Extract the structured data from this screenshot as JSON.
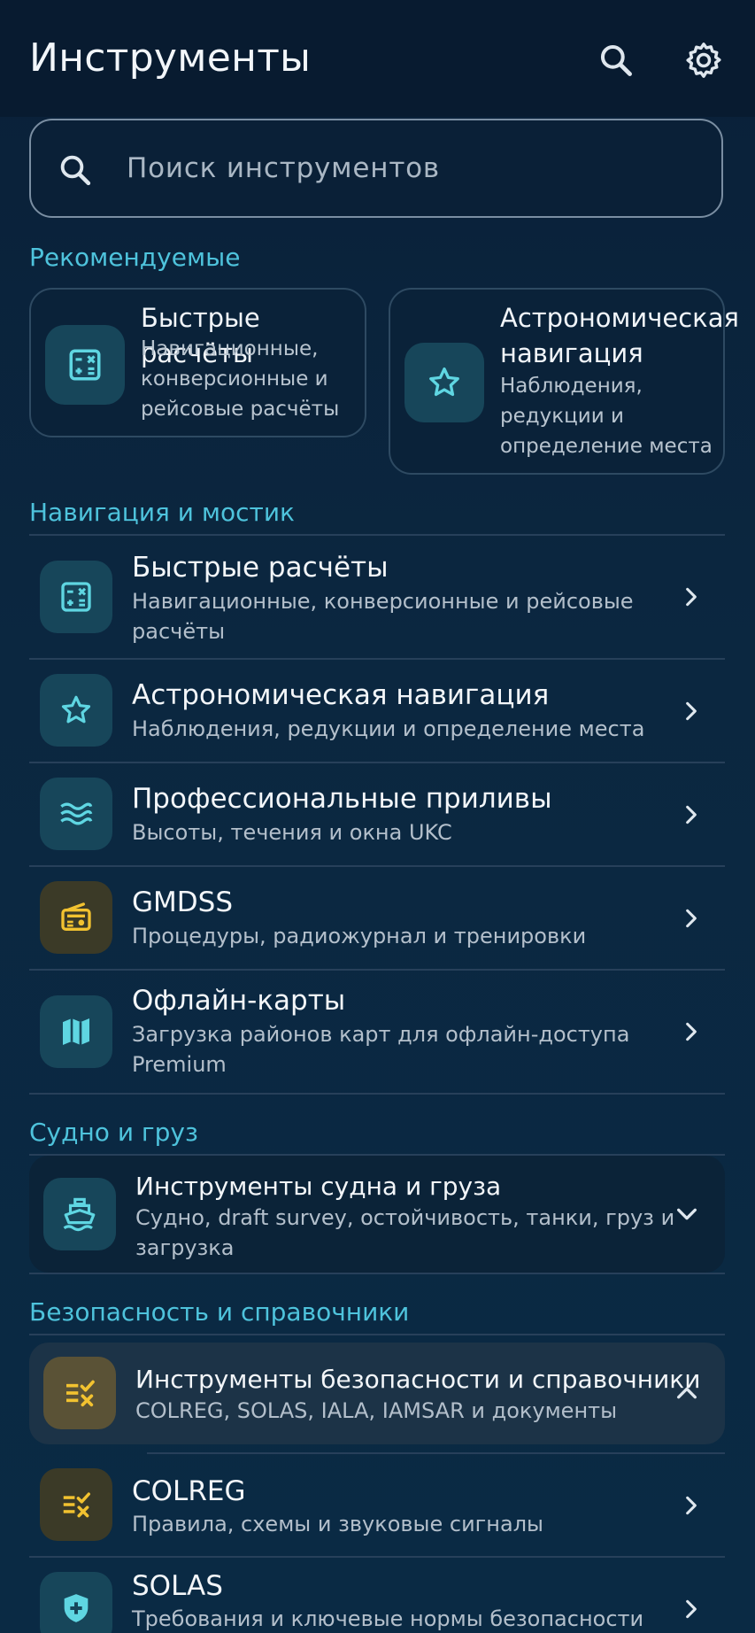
{
  "appbar": {
    "title": "Инструменты",
    "search_icon": "search-icon",
    "settings_icon": "gear-icon"
  },
  "search": {
    "placeholder": "Поиск инструментов"
  },
  "recommended": {
    "title": "Рекомендуемые",
    "cards": [
      {
        "title": "Быстрые расчёты",
        "desc_lines": [
          "Навигационные,",
          "конверсионные и",
          "рейсовые расчёты"
        ],
        "icon": "calculator-icon"
      },
      {
        "title_lines": [
          "Астрономическая",
          "навигация"
        ],
        "desc_lines": [
          "Наблюдения,",
          "редукции и",
          "определение места"
        ],
        "icon": "star-icon"
      }
    ]
  },
  "navigation": {
    "title": "Навигация и мостик",
    "items": [
      {
        "title": "Быстрые расчёты",
        "desc_lines": [
          "Навигационные, конверсионные и рейсовые",
          "расчёты"
        ],
        "icon": "calculator-icon"
      },
      {
        "title": "Астрономическая навигация",
        "desc_lines": [
          "Наблюдения, редукции и определение места"
        ],
        "icon": "star-icon"
      },
      {
        "title": "Профессиональные приливы",
        "desc_lines": [
          "Высоты, течения и окна UKC"
        ],
        "icon": "waves-icon"
      },
      {
        "title": "GMDSS",
        "desc_lines": [
          "Процедуры, радиожурнал и тренировки"
        ],
        "icon": "radio-icon"
      },
      {
        "title": "Офлайн-карты",
        "desc_lines": [
          "Загрузка районов карт для офлайн-доступа",
          "Premium"
        ],
        "icon": "map-icon"
      }
    ]
  },
  "vessel": {
    "title": "Судно и груз",
    "group": {
      "title": "Инструменты судна и груза",
      "desc_lines": [
        "Судно, draft survey, остойчивость, танки, груз и",
        "загрузка"
      ],
      "icon": "ship-icon"
    }
  },
  "safety": {
    "title": "Безопасность и справочники",
    "group": {
      "title": "Инструменты безопасности и справочники",
      "desc_lines": [
        "COLREG, SOLAS, IALA, IAMSAR и документы"
      ],
      "icon": "checklist-icon"
    },
    "items": [
      {
        "title": "COLREG",
        "desc_lines": [
          "Правила, схемы и звуковые сигналы"
        ],
        "icon": "checklist-icon"
      },
      {
        "title": "SOLAS",
        "desc_lines": [
          "Требования и ключевые нормы безопасности"
        ],
        "icon": "shield-icon"
      }
    ]
  },
  "colors": {
    "accent": "#4ec3dc",
    "amber": "#f2c230",
    "icon_bg": "#17465a"
  }
}
